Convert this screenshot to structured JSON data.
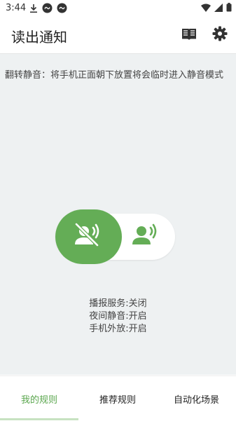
{
  "status_bar": {
    "time": "3:44",
    "icons_left": [
      "download-icon",
      "app-notification-icon",
      "app-notification-icon"
    ],
    "icons_right": [
      "wifi-icon",
      "signal-icon",
      "battery-icon"
    ]
  },
  "app_bar": {
    "title": "读出通知",
    "actions": [
      "book-icon",
      "gear-icon"
    ]
  },
  "content": {
    "marquee_text": "翻转静音：将手机正面朝下放置将会临时进入静音模式",
    "toggle": {
      "state": "off",
      "active_icon": "mute-voice-icon",
      "inactive_icon": "voice-icon"
    },
    "status": {
      "broadcast_service": "播报服务:关闭",
      "night_mute": "夜间静音:开启",
      "speaker": "手机外放:开启"
    }
  },
  "bottom_nav": {
    "tabs": [
      {
        "label": "我的规则",
        "active": true
      },
      {
        "label": "推荐规则",
        "active": false
      },
      {
        "label": "自动化场景",
        "active": false
      }
    ]
  },
  "colors": {
    "accent": "#64ad56",
    "background": "#eef1f2"
  }
}
